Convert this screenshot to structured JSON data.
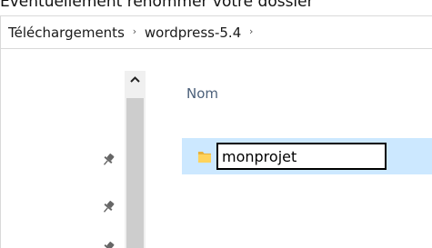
{
  "caption": {
    "text": "Eventuellement renommer votre dossier"
  },
  "breadcrumb": {
    "items": [
      {
        "label": "Téléchargements"
      },
      {
        "label": "wordpress-5.4"
      }
    ],
    "separator": "›"
  },
  "file_list": {
    "column_header": "Nom",
    "rows": [
      {
        "name": "monprojet",
        "icon": "folder-icon",
        "state": "renaming"
      }
    ]
  },
  "quick_access": {
    "pin_icon": "pin-icon",
    "pin_count": 3
  },
  "colors": {
    "selection": "#cce8ff",
    "header_text": "#4c607a",
    "folder": "#ffd35c",
    "scrollbar_thumb": "#cdcdcd"
  }
}
